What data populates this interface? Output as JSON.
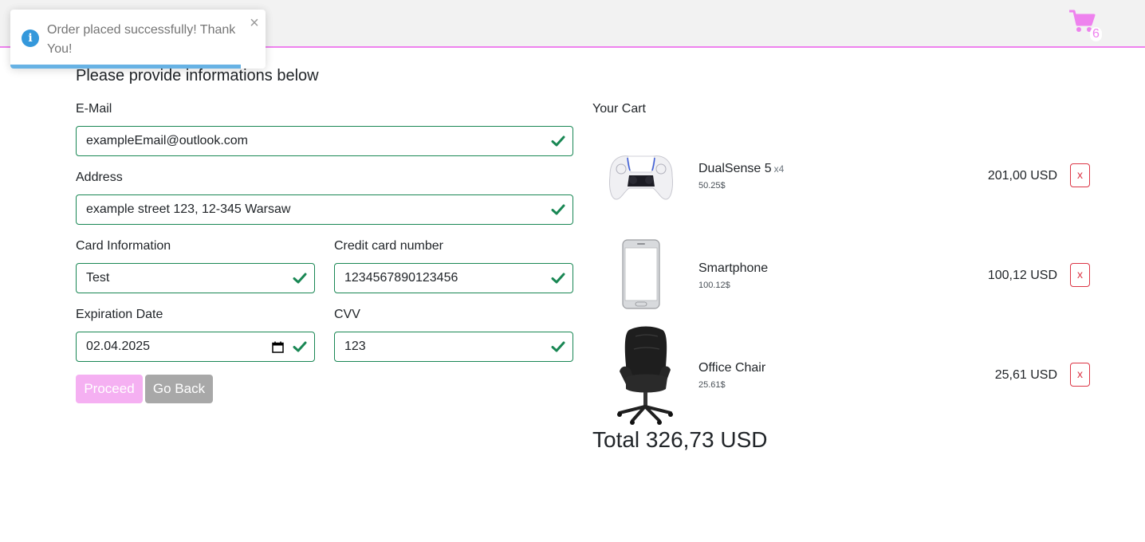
{
  "header": {
    "cart_count": "6",
    "cart_icon": "shopping-cart-icon",
    "accent_color": "#ee82ee"
  },
  "toast": {
    "message": "Order placed successfully! Thank You!",
    "close": "×",
    "icon": "info-icon",
    "color": "#3498db"
  },
  "form": {
    "title": "Please provide informations below",
    "email": {
      "label": "E-Mail",
      "value": "exampleEmail@outlook.com"
    },
    "address": {
      "label": "Address",
      "value": "example street 123, 12-345 Warsaw"
    },
    "card_info": {
      "label": "Card Information",
      "value": "Test"
    },
    "card_number": {
      "label": "Credit card number",
      "value": "1234567890123456"
    },
    "expiration": {
      "label": "Expiration Date",
      "value": "02.04.2025"
    },
    "cvv": {
      "label": "CVV",
      "value": "123"
    },
    "valid_color": "#198754",
    "proceed_label": "Proceed",
    "back_label": "Go Back"
  },
  "cart": {
    "title": "Your Cart",
    "items": [
      {
        "name": "DualSense 5",
        "qty": "x4",
        "unit_price": "50.25$",
        "total": "201,00 USD",
        "remove": "x"
      },
      {
        "name": "Smartphone",
        "qty": "",
        "unit_price": "100.12$",
        "total": "100,12 USD",
        "remove": "x"
      },
      {
        "name": "Office Chair",
        "qty": "",
        "unit_price": "25.61$",
        "total": "25,61 USD",
        "remove": "x"
      }
    ],
    "total": "Total 326,73 USD"
  }
}
